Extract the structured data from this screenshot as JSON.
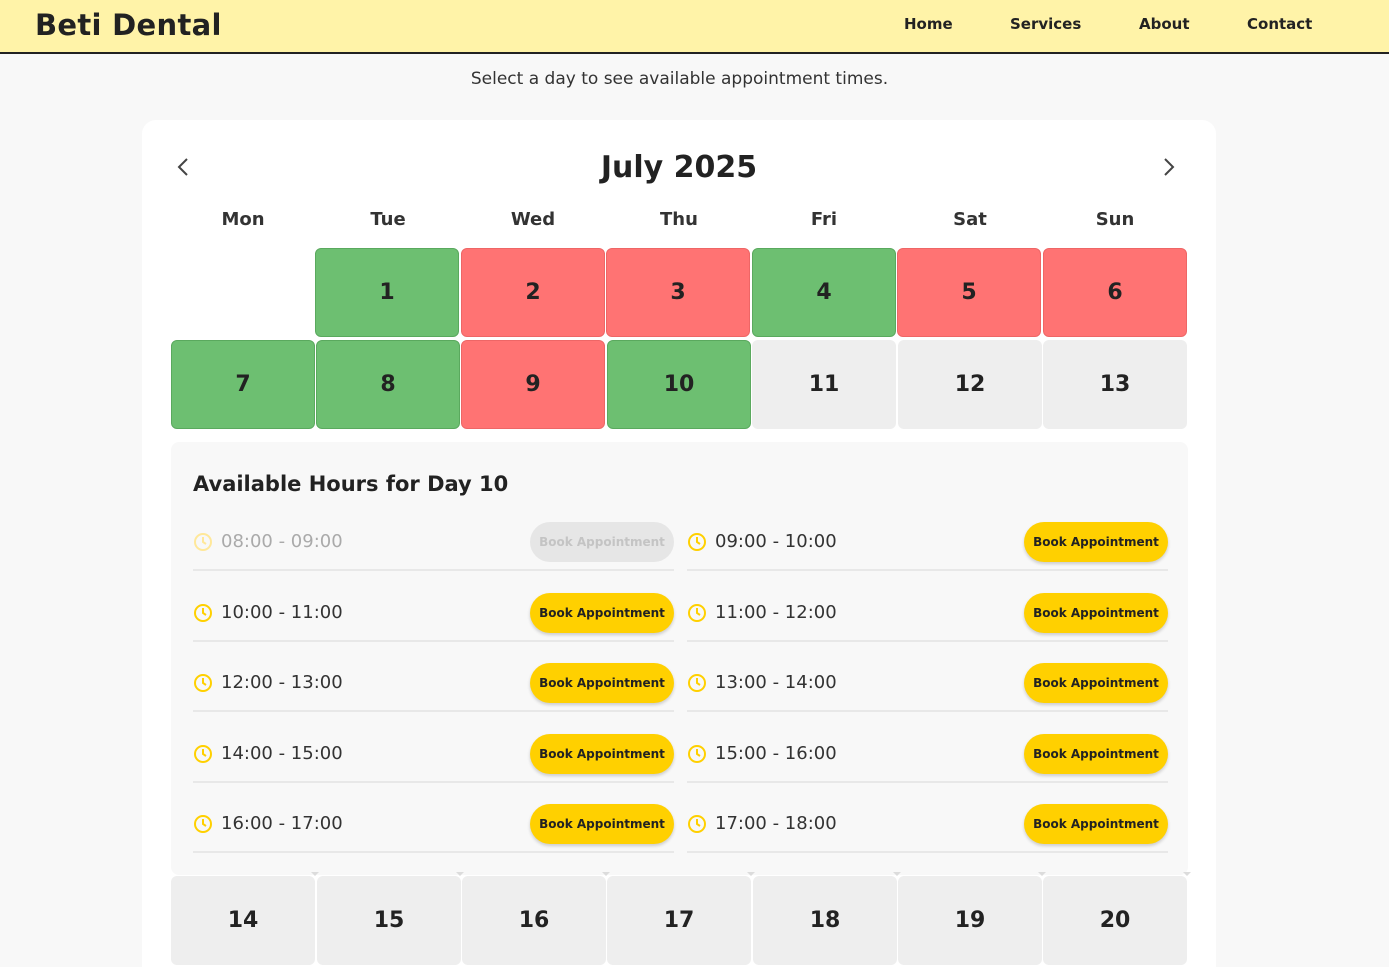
{
  "brand": "Beti Dental",
  "nav": [
    {
      "label": "Home"
    },
    {
      "label": "Services"
    },
    {
      "label": "About"
    },
    {
      "label": "Contact"
    }
  ],
  "subtitle": "Select a day to see available appointment times.",
  "calendar": {
    "month_title": "July 2025",
    "prev_icon": "chevron-left-icon",
    "next_icon": "chevron-right-icon",
    "weekdays": [
      "Mon",
      "Tue",
      "Wed",
      "Thu",
      "Fri",
      "Sat",
      "Sun"
    ],
    "status_colors": {
      "available": "#6dbf71",
      "full": "#ff7373",
      "unavailable": "#eeeeee"
    },
    "week1": [
      {
        "label": "1",
        "status": "available"
      },
      {
        "label": "2",
        "status": "full"
      },
      {
        "label": "3",
        "status": "full"
      },
      {
        "label": "4",
        "status": "available"
      },
      {
        "label": "5",
        "status": "full"
      },
      {
        "label": "6",
        "status": "full"
      }
    ],
    "week2": [
      {
        "label": "7",
        "status": "available"
      },
      {
        "label": "8",
        "status": "available"
      },
      {
        "label": "9",
        "status": "full"
      },
      {
        "label": "10",
        "status": "available"
      },
      {
        "label": "11",
        "status": "unavailable"
      },
      {
        "label": "12",
        "status": "unavailable"
      },
      {
        "label": "13",
        "status": "unavailable"
      }
    ],
    "week3": [
      {
        "label": "14",
        "status": "unavailable"
      },
      {
        "label": "15",
        "status": "unavailable"
      },
      {
        "label": "16",
        "status": "unavailable"
      },
      {
        "label": "17",
        "status": "unavailable"
      },
      {
        "label": "18",
        "status": "unavailable"
      },
      {
        "label": "19",
        "status": "unavailable"
      },
      {
        "label": "20",
        "status": "unavailable"
      }
    ]
  },
  "hours": {
    "title": "Available Hours for Day 10",
    "clock_icon": "clock-icon",
    "accent": "#ffd000",
    "slots": [
      {
        "time": "08:00 - 09:00",
        "button": "Book Appointment",
        "disabled": true
      },
      {
        "time": "09:00 - 10:00",
        "button": "Book Appointment",
        "disabled": false
      },
      {
        "time": "10:00 - 11:00",
        "button": "Book Appointment",
        "disabled": false
      },
      {
        "time": "11:00 - 12:00",
        "button": "Book Appointment",
        "disabled": false
      },
      {
        "time": "12:00 - 13:00",
        "button": "Book Appointment",
        "disabled": false
      },
      {
        "time": "13:00 - 14:00",
        "button": "Book Appointment",
        "disabled": false
      },
      {
        "time": "14:00 - 15:00",
        "button": "Book Appointment",
        "disabled": false
      },
      {
        "time": "15:00 - 16:00",
        "button": "Book Appointment",
        "disabled": false
      },
      {
        "time": "16:00 - 17:00",
        "button": "Book Appointment",
        "disabled": false
      },
      {
        "time": "17:00 - 18:00",
        "button": "Book Appointment",
        "disabled": false
      }
    ]
  }
}
